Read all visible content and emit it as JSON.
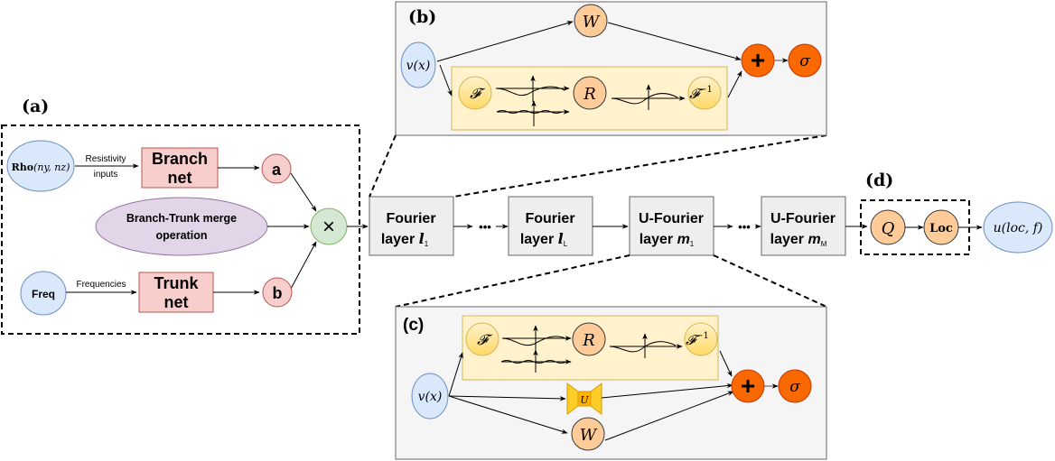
{
  "panels": {
    "a": {
      "label": "(a)"
    },
    "b": {
      "label": "(b)"
    },
    "c": {
      "label": "(c)"
    },
    "d": {
      "label": "(d)"
    }
  },
  "branch_trunk": {
    "rho_node": {
      "bold": "Rho",
      "args": "(ny, nz)"
    },
    "resistivity_label": [
      "Resistivity",
      "inputs"
    ],
    "branch_net": [
      "Branch",
      "net"
    ],
    "node_a": "a",
    "merge_op": [
      "Branch-Trunk merge",
      "operation"
    ],
    "multiply_symbol": "×",
    "freq_node": "Freq",
    "frequencies_label": "Frequencies",
    "trunk_net": [
      "Trunk",
      "net"
    ],
    "node_b": "b"
  },
  "pipeline": {
    "fourier_1": {
      "line1": "Fourier",
      "line2": "layer",
      "var": "l",
      "sub": "1"
    },
    "fourier_L": {
      "line1": "Fourier",
      "line2": "layer",
      "var": "l",
      "sub": "L"
    },
    "ufourier_1": {
      "line1": "U-Fourier",
      "line2": "layer",
      "var": "m",
      "sub": "1"
    },
    "ufourier_M": {
      "line1": "U-Fourier",
      "line2": "layer",
      "var": "m",
      "sub": "M"
    },
    "ellipsis": "•••",
    "q_node": "Q",
    "loc_node": "Loc",
    "output_node": "u(loc, f)"
  },
  "fourier_layer": {
    "input": "v(x)",
    "w": "W",
    "f": "𝓕",
    "r": "R",
    "f_inv": "𝓕",
    "f_inv_sup": "−1",
    "plus": "+",
    "sigma": "σ"
  },
  "ufourier_layer": {
    "input": "v(x)",
    "w": "W",
    "u": "U",
    "f": "𝓕",
    "r": "R",
    "f_inv": "𝓕",
    "f_inv_sup": "−1",
    "plus": "+",
    "sigma": "σ"
  },
  "colors": {
    "blue_fill": "#dae8fc",
    "blue_stroke": "#6c8ebf",
    "red_fill": "#f8cecc",
    "red_stroke": "#b85450",
    "purple_fill": "#e1d5e7",
    "purple_stroke": "#9673a6",
    "green_fill": "#d5e8d4",
    "green_stroke": "#82b366",
    "gray_fill": "#f5f5f5",
    "gray_box": "#eeeeee",
    "orange_light": "#ffcc99",
    "orange_dark": "#fa6800",
    "yellow_fill": "#fff2cc",
    "yellow_stroke": "#d6b656"
  }
}
